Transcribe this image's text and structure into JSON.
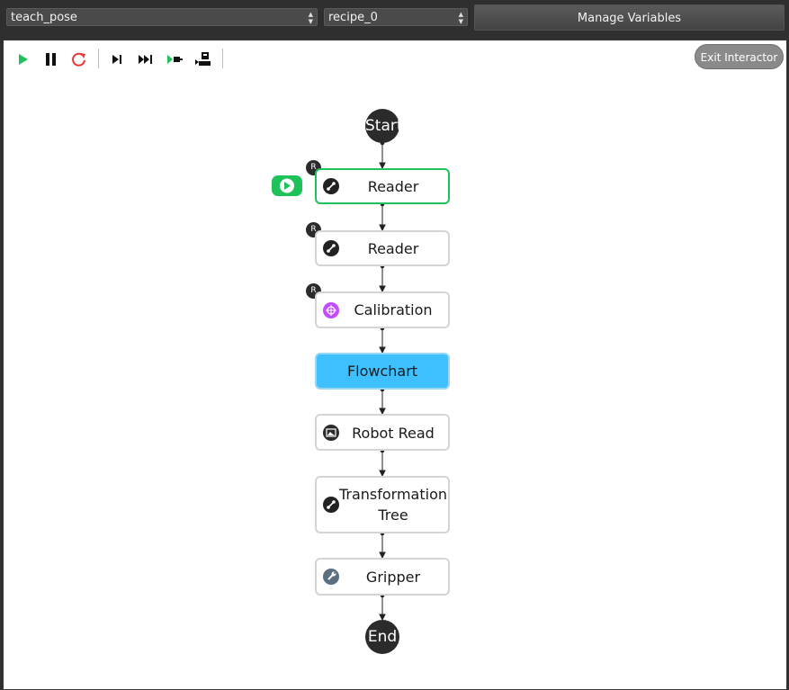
{
  "toolbar_top": {
    "flow_select": "teach_pose",
    "recipe_select": "recipe_0",
    "manage_label": "Manage Variables"
  },
  "toolbar_canvas": {
    "icons": [
      "play-icon",
      "pause-icon",
      "restart-icon",
      "step-icon",
      "step-over-icon",
      "run-to-icon",
      "robot-step-icon"
    ],
    "exit_label": "Exit Interactor"
  },
  "flow": {
    "start_label": "Start",
    "end_label": "End",
    "nodes": [
      {
        "label": "Reader",
        "badge": "R",
        "icon": "link-icon",
        "state": "active"
      },
      {
        "label": "Reader",
        "badge": "R",
        "icon": "link-icon",
        "state": "normal"
      },
      {
        "label": "Calibration",
        "badge": "R",
        "icon": "target-icon",
        "state": "normal"
      },
      {
        "label": "Flowchart",
        "badge": "",
        "icon": "",
        "state": "highlighted"
      },
      {
        "label": "Robot Read",
        "badge": "",
        "icon": "image-icon",
        "state": "normal"
      },
      {
        "label_line1": "Transformation",
        "label_line2": "Tree",
        "badge": "",
        "icon": "link-icon",
        "state": "normal"
      },
      {
        "label": "Gripper",
        "badge": "",
        "icon": "wrench-icon",
        "state": "normal"
      }
    ]
  },
  "colors": {
    "accent_green": "#1fc25a",
    "flowchart_blue": "#3ec0ff",
    "calibration_purple": "#c04dff",
    "restart_red": "#e53935",
    "node_border": "#d4d4d4"
  }
}
